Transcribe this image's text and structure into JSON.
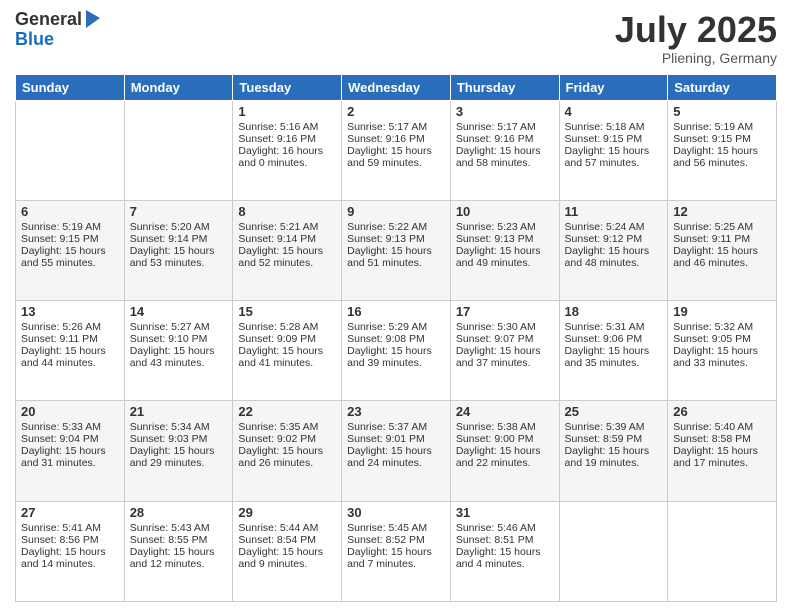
{
  "logo": {
    "general": "General",
    "blue": "Blue"
  },
  "title": "July 2025",
  "location": "Pliening, Germany",
  "days_of_week": [
    "Sunday",
    "Monday",
    "Tuesday",
    "Wednesday",
    "Thursday",
    "Friday",
    "Saturday"
  ],
  "weeks": [
    [
      {
        "day": "",
        "sunrise": "",
        "sunset": "",
        "daylight": ""
      },
      {
        "day": "",
        "sunrise": "",
        "sunset": "",
        "daylight": ""
      },
      {
        "day": "1",
        "sunrise": "Sunrise: 5:16 AM",
        "sunset": "Sunset: 9:16 PM",
        "daylight": "Daylight: 16 hours and 0 minutes."
      },
      {
        "day": "2",
        "sunrise": "Sunrise: 5:17 AM",
        "sunset": "Sunset: 9:16 PM",
        "daylight": "Daylight: 15 hours and 59 minutes."
      },
      {
        "day": "3",
        "sunrise": "Sunrise: 5:17 AM",
        "sunset": "Sunset: 9:16 PM",
        "daylight": "Daylight: 15 hours and 58 minutes."
      },
      {
        "day": "4",
        "sunrise": "Sunrise: 5:18 AM",
        "sunset": "Sunset: 9:15 PM",
        "daylight": "Daylight: 15 hours and 57 minutes."
      },
      {
        "day": "5",
        "sunrise": "Sunrise: 5:19 AM",
        "sunset": "Sunset: 9:15 PM",
        "daylight": "Daylight: 15 hours and 56 minutes."
      }
    ],
    [
      {
        "day": "6",
        "sunrise": "Sunrise: 5:19 AM",
        "sunset": "Sunset: 9:15 PM",
        "daylight": "Daylight: 15 hours and 55 minutes."
      },
      {
        "day": "7",
        "sunrise": "Sunrise: 5:20 AM",
        "sunset": "Sunset: 9:14 PM",
        "daylight": "Daylight: 15 hours and 53 minutes."
      },
      {
        "day": "8",
        "sunrise": "Sunrise: 5:21 AM",
        "sunset": "Sunset: 9:14 PM",
        "daylight": "Daylight: 15 hours and 52 minutes."
      },
      {
        "day": "9",
        "sunrise": "Sunrise: 5:22 AM",
        "sunset": "Sunset: 9:13 PM",
        "daylight": "Daylight: 15 hours and 51 minutes."
      },
      {
        "day": "10",
        "sunrise": "Sunrise: 5:23 AM",
        "sunset": "Sunset: 9:13 PM",
        "daylight": "Daylight: 15 hours and 49 minutes."
      },
      {
        "day": "11",
        "sunrise": "Sunrise: 5:24 AM",
        "sunset": "Sunset: 9:12 PM",
        "daylight": "Daylight: 15 hours and 48 minutes."
      },
      {
        "day": "12",
        "sunrise": "Sunrise: 5:25 AM",
        "sunset": "Sunset: 9:11 PM",
        "daylight": "Daylight: 15 hours and 46 minutes."
      }
    ],
    [
      {
        "day": "13",
        "sunrise": "Sunrise: 5:26 AM",
        "sunset": "Sunset: 9:11 PM",
        "daylight": "Daylight: 15 hours and 44 minutes."
      },
      {
        "day": "14",
        "sunrise": "Sunrise: 5:27 AM",
        "sunset": "Sunset: 9:10 PM",
        "daylight": "Daylight: 15 hours and 43 minutes."
      },
      {
        "day": "15",
        "sunrise": "Sunrise: 5:28 AM",
        "sunset": "Sunset: 9:09 PM",
        "daylight": "Daylight: 15 hours and 41 minutes."
      },
      {
        "day": "16",
        "sunrise": "Sunrise: 5:29 AM",
        "sunset": "Sunset: 9:08 PM",
        "daylight": "Daylight: 15 hours and 39 minutes."
      },
      {
        "day": "17",
        "sunrise": "Sunrise: 5:30 AM",
        "sunset": "Sunset: 9:07 PM",
        "daylight": "Daylight: 15 hours and 37 minutes."
      },
      {
        "day": "18",
        "sunrise": "Sunrise: 5:31 AM",
        "sunset": "Sunset: 9:06 PM",
        "daylight": "Daylight: 15 hours and 35 minutes."
      },
      {
        "day": "19",
        "sunrise": "Sunrise: 5:32 AM",
        "sunset": "Sunset: 9:05 PM",
        "daylight": "Daylight: 15 hours and 33 minutes."
      }
    ],
    [
      {
        "day": "20",
        "sunrise": "Sunrise: 5:33 AM",
        "sunset": "Sunset: 9:04 PM",
        "daylight": "Daylight: 15 hours and 31 minutes."
      },
      {
        "day": "21",
        "sunrise": "Sunrise: 5:34 AM",
        "sunset": "Sunset: 9:03 PM",
        "daylight": "Daylight: 15 hours and 29 minutes."
      },
      {
        "day": "22",
        "sunrise": "Sunrise: 5:35 AM",
        "sunset": "Sunset: 9:02 PM",
        "daylight": "Daylight: 15 hours and 26 minutes."
      },
      {
        "day": "23",
        "sunrise": "Sunrise: 5:37 AM",
        "sunset": "Sunset: 9:01 PM",
        "daylight": "Daylight: 15 hours and 24 minutes."
      },
      {
        "day": "24",
        "sunrise": "Sunrise: 5:38 AM",
        "sunset": "Sunset: 9:00 PM",
        "daylight": "Daylight: 15 hours and 22 minutes."
      },
      {
        "day": "25",
        "sunrise": "Sunrise: 5:39 AM",
        "sunset": "Sunset: 8:59 PM",
        "daylight": "Daylight: 15 hours and 19 minutes."
      },
      {
        "day": "26",
        "sunrise": "Sunrise: 5:40 AM",
        "sunset": "Sunset: 8:58 PM",
        "daylight": "Daylight: 15 hours and 17 minutes."
      }
    ],
    [
      {
        "day": "27",
        "sunrise": "Sunrise: 5:41 AM",
        "sunset": "Sunset: 8:56 PM",
        "daylight": "Daylight: 15 hours and 14 minutes."
      },
      {
        "day": "28",
        "sunrise": "Sunrise: 5:43 AM",
        "sunset": "Sunset: 8:55 PM",
        "daylight": "Daylight: 15 hours and 12 minutes."
      },
      {
        "day": "29",
        "sunrise": "Sunrise: 5:44 AM",
        "sunset": "Sunset: 8:54 PM",
        "daylight": "Daylight: 15 hours and 9 minutes."
      },
      {
        "day": "30",
        "sunrise": "Sunrise: 5:45 AM",
        "sunset": "Sunset: 8:52 PM",
        "daylight": "Daylight: 15 hours and 7 minutes."
      },
      {
        "day": "31",
        "sunrise": "Sunrise: 5:46 AM",
        "sunset": "Sunset: 8:51 PM",
        "daylight": "Daylight: 15 hours and 4 minutes."
      },
      {
        "day": "",
        "sunrise": "",
        "sunset": "",
        "daylight": ""
      },
      {
        "day": "",
        "sunrise": "",
        "sunset": "",
        "daylight": ""
      }
    ]
  ]
}
